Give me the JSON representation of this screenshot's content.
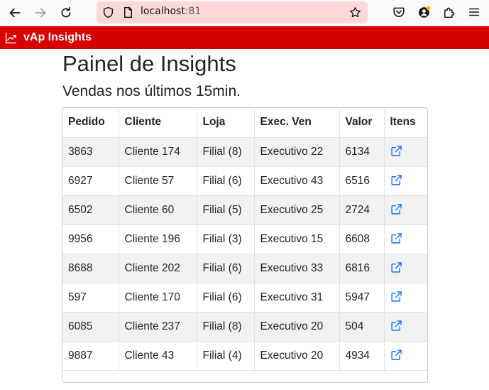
{
  "browser": {
    "url_host": "localhost",
    "url_port": ":81"
  },
  "app": {
    "brand": "vAp Insights",
    "brand_color": "#d70000"
  },
  "page": {
    "title": "Painel de Insights",
    "subtitle": "Vendas nos últimos 15min."
  },
  "table": {
    "headers": [
      "Pedido",
      "Cliente",
      "Loja",
      "Exec. Ven",
      "Valor",
      "Itens"
    ],
    "rows": [
      [
        "3863",
        "Cliente 174",
        "Filial (8)",
        "Executivo 22",
        "6134"
      ],
      [
        "6927",
        "Cliente 57",
        "Filial (6)",
        "Executivo 43",
        "6516"
      ],
      [
        "6502",
        "Cliente 60",
        "Filial (5)",
        "Executivo 25",
        "2724"
      ],
      [
        "9956",
        "Cliente 196",
        "Filial (3)",
        "Executivo 15",
        "6608"
      ],
      [
        "8688",
        "Cliente 202",
        "Filial (6)",
        "Executivo 33",
        "6816"
      ],
      [
        "597",
        "Cliente 170",
        "Filial (6)",
        "Executivo 31",
        "5947"
      ],
      [
        "6085",
        "Cliente 237",
        "Filial (8)",
        "Executivo 20",
        "504"
      ],
      [
        "9887",
        "Cliente 43",
        "Filial (4)",
        "Executivo 20",
        "4934"
      ]
    ],
    "items_icon": "external-link-icon",
    "link_color": "#0d6efd"
  }
}
